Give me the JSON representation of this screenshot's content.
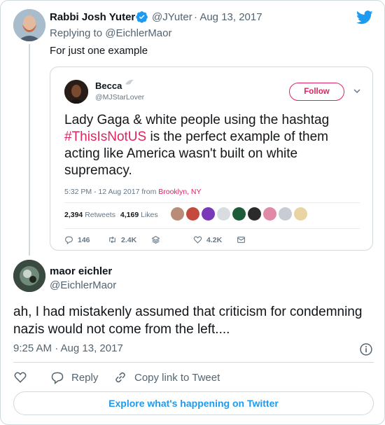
{
  "tweet": {
    "author_name": "Rabbi Josh Yuter",
    "author_handle": "@JYuter",
    "date": "· Aug 13, 2017",
    "replying_label": "Replying to",
    "replying_handle": "@EichlerMaor",
    "text": "For just one example"
  },
  "quoted": {
    "name": "Becca",
    "handle": "@MJStarLover",
    "follow_label": "Follow",
    "text_before": "Lady Gaga & white people using the hashtag ",
    "hashtag": "#ThisIsNotUS",
    "text_after": " is the perfect example of them acting like America wasn't built on white supremacy.",
    "time": "5:32 PM - 12 Aug 2017 from ",
    "location": "Brooklyn, NY",
    "retweets_count": "2,394",
    "retweets_label": "Retweets",
    "likes_count": "4,169",
    "likes_label": "Likes",
    "reply_count": "146",
    "retweet_action_count": "2.4K",
    "like_action_count": "4.2K"
  },
  "reply": {
    "author_name": "maor eichler",
    "author_handle": "@EichlerMaor",
    "text": "ah, I had mistakenly assumed that criticism for condemning nazis would not come from the left....",
    "timestamp": "9:25 AM · Aug 13, 2017"
  },
  "actions": {
    "reply_label": "Reply",
    "copy_label": "Copy link to Tweet"
  },
  "explore_label": "Explore what's happening on Twitter",
  "colors": {
    "twitter_blue": "#1d9bf0",
    "quoted_accent": "#e0245e",
    "secondary_text": "#536471",
    "border": "#cfd9de"
  },
  "icons": [
    "verified-badge-icon",
    "twitter-bird-icon",
    "chevron-down-icon",
    "reply-icon",
    "retweet-icon",
    "layers-icon",
    "heart-icon",
    "mail-icon",
    "info-icon",
    "copy-link-icon"
  ]
}
